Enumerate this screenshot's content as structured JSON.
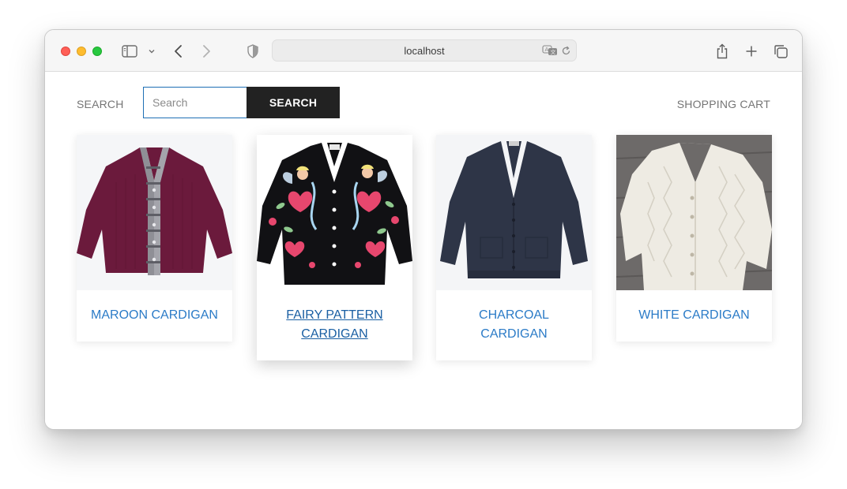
{
  "browser": {
    "url": "localhost",
    "icons": [
      "sidebar-icon",
      "chevron-down-icon",
      "back-icon",
      "forward-icon",
      "shield-icon",
      "translate-icon",
      "reload-icon",
      "share-icon",
      "plus-icon",
      "tabs-icon"
    ]
  },
  "header": {
    "search_label": "SEARCH",
    "search_placeholder": "Search",
    "search_value": "",
    "search_button": "SEARCH",
    "cart_link": "SHOPPING CART"
  },
  "products": [
    {
      "name": "Maroon Cardigan",
      "hovered": false
    },
    {
      "name": "Fairy Pattern Cardigan",
      "hovered": true
    },
    {
      "name": "Charcoal Cardigan",
      "hovered": false
    },
    {
      "name": "White Cardigan",
      "hovered": false
    }
  ],
  "colors": {
    "link": "#2b7bc7",
    "button_bg": "#222222",
    "input_focus": "#1e6fb5"
  }
}
